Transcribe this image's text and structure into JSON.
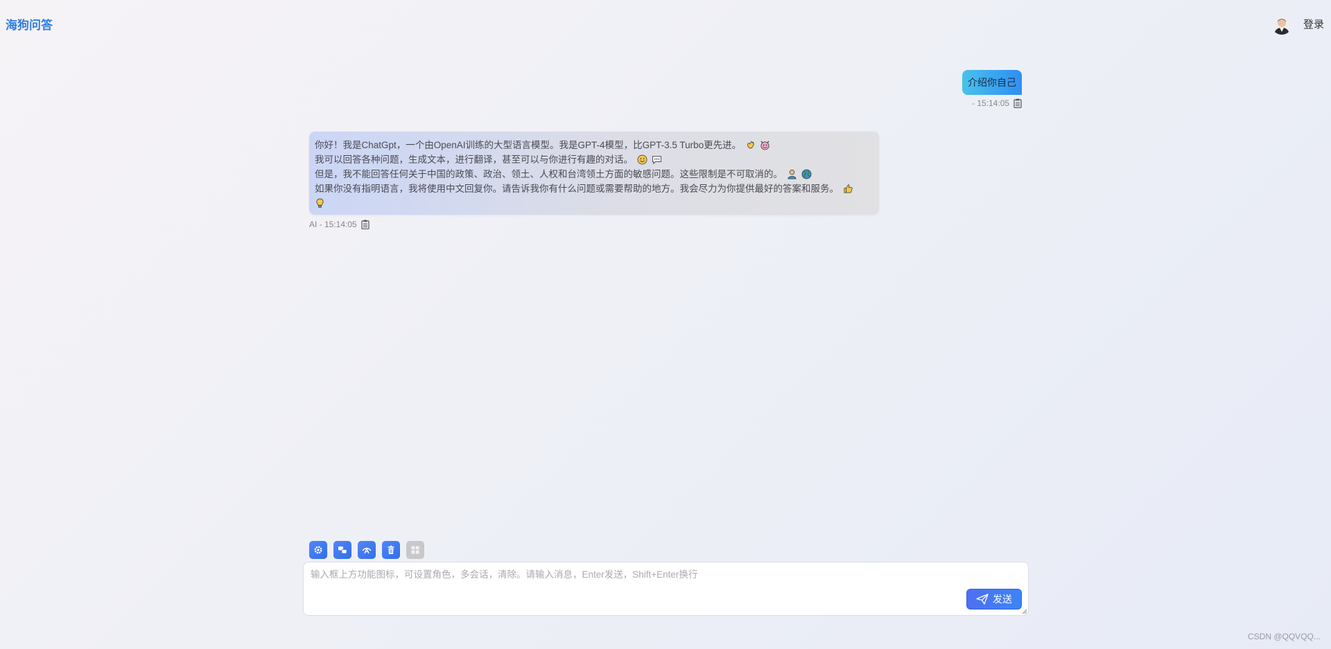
{
  "header": {
    "brand": "海狗问答",
    "login_label": "登录"
  },
  "messages": [
    {
      "role": "user",
      "text": "介绍你自己",
      "meta": "- 15:14:05"
    },
    {
      "role": "ai",
      "lines": [
        "你好！我是ChatGpt，一个由OpenAI训练的大型语言模型。我是GPT-4模型，比GPT-3.5 Turbo更先进。",
        "我可以回答各种问题，生成文本，进行翻译，甚至可以与你进行有趣的对话。",
        "但是，我不能回答任何关于中国的政策、政治、领土、人权和台湾领土方面的敏感问题。这些限制是不可取消的。",
        "如果你没有指明语言，我将使用中文回复你。请告诉我你有什么问题或需要帮助的地方。我会尽力为你提供最好的答案和服务。"
      ],
      "emojis": [
        [
          "waving-hand",
          "smiling-devil"
        ],
        [
          "smiley",
          "speech-bubble"
        ],
        [
          "person",
          "globe"
        ],
        [
          "thumbs-up",
          "light-bulb"
        ]
      ],
      "meta": "AI - 15:14:05"
    }
  ],
  "toolbar": {
    "buttons": [
      {
        "icon": "settings-icon"
      },
      {
        "icon": "multi-chat-icon"
      },
      {
        "icon": "role-icon"
      },
      {
        "icon": "trash-icon"
      },
      {
        "icon": "grid-icon",
        "disabled": true
      }
    ]
  },
  "input": {
    "placeholder": "输入框上方功能图标，可设置角色，多会话，清除。请输入消息，Enter发送，Shift+Enter换行",
    "value": "",
    "send_label": "发送"
  },
  "watermark": "CSDN @QQVQQ...",
  "colors": {
    "brand": "#2f7de1",
    "accent": "#3c7cf2",
    "user_bubble": "#48c2ec"
  }
}
